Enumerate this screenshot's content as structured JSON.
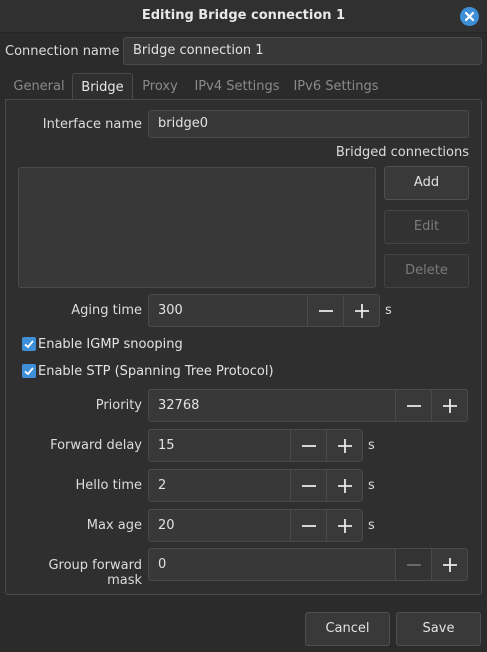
{
  "window": {
    "title": "Editing Bridge connection 1",
    "close_icon": "close-icon",
    "accent": "#3d8fd8"
  },
  "connection": {
    "label": "Connection name",
    "value": "Bridge connection 1"
  },
  "tabs": [
    {
      "label": "General",
      "active": false
    },
    {
      "label": "Bridge",
      "active": true
    },
    {
      "label": "Proxy",
      "active": false
    },
    {
      "label": "IPv4 Settings",
      "active": false
    },
    {
      "label": "IPv6 Settings",
      "active": false
    }
  ],
  "bridge": {
    "interface": {
      "label": "Interface name",
      "value": "bridge0"
    },
    "bridged_label": "Bridged connections",
    "buttons": {
      "add": "Add",
      "edit": "Edit",
      "delete": "Delete"
    },
    "aging": {
      "label": "Aging time",
      "value": "300",
      "unit": "s"
    },
    "igmp": {
      "label": "Enable IGMP snooping",
      "checked": true
    },
    "stp": {
      "label": "Enable STP (Spanning Tree Protocol)",
      "checked": true
    },
    "priority": {
      "label": "Priority",
      "value": "32768"
    },
    "forward_delay": {
      "label": "Forward delay",
      "value": "15",
      "unit": "s"
    },
    "hello_time": {
      "label": "Hello time",
      "value": "2",
      "unit": "s"
    },
    "max_age": {
      "label": "Max age",
      "value": "20",
      "unit": "s"
    },
    "group_mask": {
      "label": "Group forward mask",
      "value": "0"
    }
  },
  "footer": {
    "cancel": "Cancel",
    "save": "Save"
  }
}
